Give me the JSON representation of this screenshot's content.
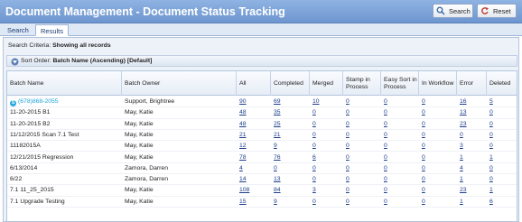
{
  "header": {
    "title": "Document Management - Document Status Tracking",
    "search_label": "Search",
    "reset_label": "Reset"
  },
  "tabs": [
    {
      "label": "Search",
      "active": false
    },
    {
      "label": "Results",
      "active": true
    }
  ],
  "criteria": {
    "label": "Search Criteria:",
    "value": "Showing all records"
  },
  "sort": {
    "label": "Sort Order:",
    "value": "Batch Name (Ascending) [Default]"
  },
  "columns": [
    "Batch Name",
    "Batch Owner",
    "All",
    "Completed",
    "Merged",
    "Stamp in Process",
    "Easy Sort in Process",
    "In Workflow",
    "Error",
    "Deleted"
  ],
  "rows": [
    [
      "(678)868-2055",
      "Support, Brightree",
      "90",
      "69",
      "10",
      "0",
      "0",
      "0",
      "16",
      "5"
    ],
    [
      "11-20-2015 B1",
      "May, Katie",
      "48",
      "35",
      "0",
      "0",
      "0",
      "0",
      "13",
      "0"
    ],
    [
      "11-20-2015 B2",
      "May, Katie",
      "48",
      "25",
      "0",
      "0",
      "0",
      "0",
      "23",
      "0"
    ],
    [
      "11/12/2015 Scan 7.1 Test",
      "May, Katie",
      "21",
      "21",
      "0",
      "0",
      "0",
      "0",
      "0",
      "0"
    ],
    [
      "11182015A",
      "May, Katie",
      "12",
      "9",
      "0",
      "0",
      "0",
      "0",
      "3",
      "0"
    ],
    [
      "12/21/2015 Regression",
      "May, Katie",
      "78",
      "76",
      "6",
      "0",
      "0",
      "0",
      "1",
      "1"
    ],
    [
      "6/13/2014",
      "Zamora, Darren",
      "4",
      "0",
      "0",
      "0",
      "0",
      "0",
      "4",
      "0"
    ],
    [
      "6/22",
      "Zamora, Darren",
      "14",
      "13",
      "0",
      "0",
      "0",
      "0",
      "1",
      "0"
    ],
    [
      "7.1 11_25_2015",
      "May, Katie",
      "108",
      "84",
      "3",
      "0",
      "0",
      "0",
      "23",
      "1"
    ],
    [
      "7.1 Upgrade Testing",
      "May, Katie",
      "15",
      "9",
      "0",
      "0",
      "0",
      "0",
      "1",
      "6"
    ]
  ],
  "colors": {
    "header_bg": "#7aa0d6",
    "link": "#1b3c8c",
    "phone_link": "#1aa3d8"
  }
}
